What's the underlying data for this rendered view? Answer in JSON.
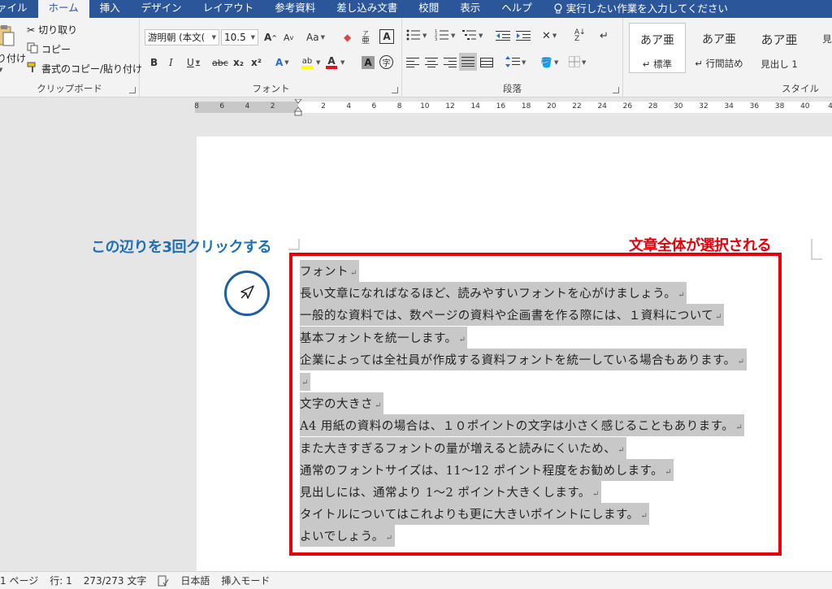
{
  "tabs": [
    {
      "label": "ァイル",
      "active": false
    },
    {
      "label": "ホーム",
      "active": true
    },
    {
      "label": "挿入",
      "active": false
    },
    {
      "label": "デザイン",
      "active": false
    },
    {
      "label": "レイアウト",
      "active": false
    },
    {
      "label": "参考資料",
      "active": false
    },
    {
      "label": "差し込み文書",
      "active": false
    },
    {
      "label": "校閲",
      "active": false
    },
    {
      "label": "表示",
      "active": false
    },
    {
      "label": "ヘルプ",
      "active": false
    }
  ],
  "tellme": {
    "label": "実行したい作業を入力してください",
    "icon": "lightbulb-icon"
  },
  "clipboard": {
    "paste_label": "り付け",
    "cut_label": "切り取り",
    "copy_label": "コピー",
    "format_painter_label": "書式のコピー/貼り付け",
    "group_label": "クリップボード"
  },
  "font": {
    "font_name": "游明朝 (本文(",
    "font_size": "10.5",
    "grow_label": "A",
    "shrink_label": "A",
    "case_label": "Aa",
    "ruby_label": "亜",
    "bold": "B",
    "italic": "I",
    "underline": "U",
    "strike": "abc",
    "subscript": "x₂",
    "superscript": "x²",
    "effects": "A",
    "highlight": "ab",
    "font_color": "A",
    "char_shading": "A",
    "enclose": "字",
    "group_label": "フォント",
    "accent_red": "#e81123",
    "accent_yellow": "#ffff00"
  },
  "paragraph": {
    "group_label": "段落"
  },
  "styles": {
    "items": [
      {
        "sample": "あア亜",
        "name": "↵ 標準",
        "selected": true
      },
      {
        "sample": "あア亜",
        "name": "↵ 行間詰め",
        "selected": false
      },
      {
        "sample": "あア亜",
        "name": "見出し 1",
        "selected": false
      },
      {
        "sample": "",
        "name": "見",
        "selected": false
      }
    ],
    "group_label": "スタイル"
  },
  "ruler": {
    "ticks": [
      "8",
      "6",
      "4",
      "2",
      "2",
      "4",
      "6",
      "8",
      "10",
      "12",
      "14",
      "16",
      "18",
      "20",
      "22",
      "24",
      "26",
      "28",
      "30",
      "32",
      "34",
      "36",
      "38",
      "40",
      "4"
    ]
  },
  "annotations": {
    "left": "この辺りを3回クリックする",
    "right": "文章全体が選択される",
    "left_color": "#1e6fb5",
    "right_color": "#e8000a"
  },
  "document": {
    "lines": [
      "フォント",
      "長い文章になればなるほど、読みやすいフォントを心がけましょう。",
      "一般的な資料では、数ページの資料や企画書を作る際には、１資料について",
      "基本フォントを統一します。",
      "企業によっては全社員が作成する資料フォントを統一している場合もあります。",
      "",
      "文字の大きさ",
      "A4 用紙の資料の場合は、１０ポイントの文字は小さく感じることもあります。",
      "また大きすぎるフォントの量が増えると読みにくいため、",
      "通常のフォントサイズは、11～12 ポイント程度をお勧めします。",
      "見出しには、通常より 1～2 ポイント大きくします。",
      "タイトルについてはこれよりも更に大きいポイントにします。",
      "よいでしょう。"
    ],
    "paragraph_mark": "↵"
  },
  "statusbar": {
    "page": "1 ページ",
    "line": "行: 1",
    "chars": "273/273 文字",
    "language": "日本語",
    "mode": "挿入モード"
  }
}
